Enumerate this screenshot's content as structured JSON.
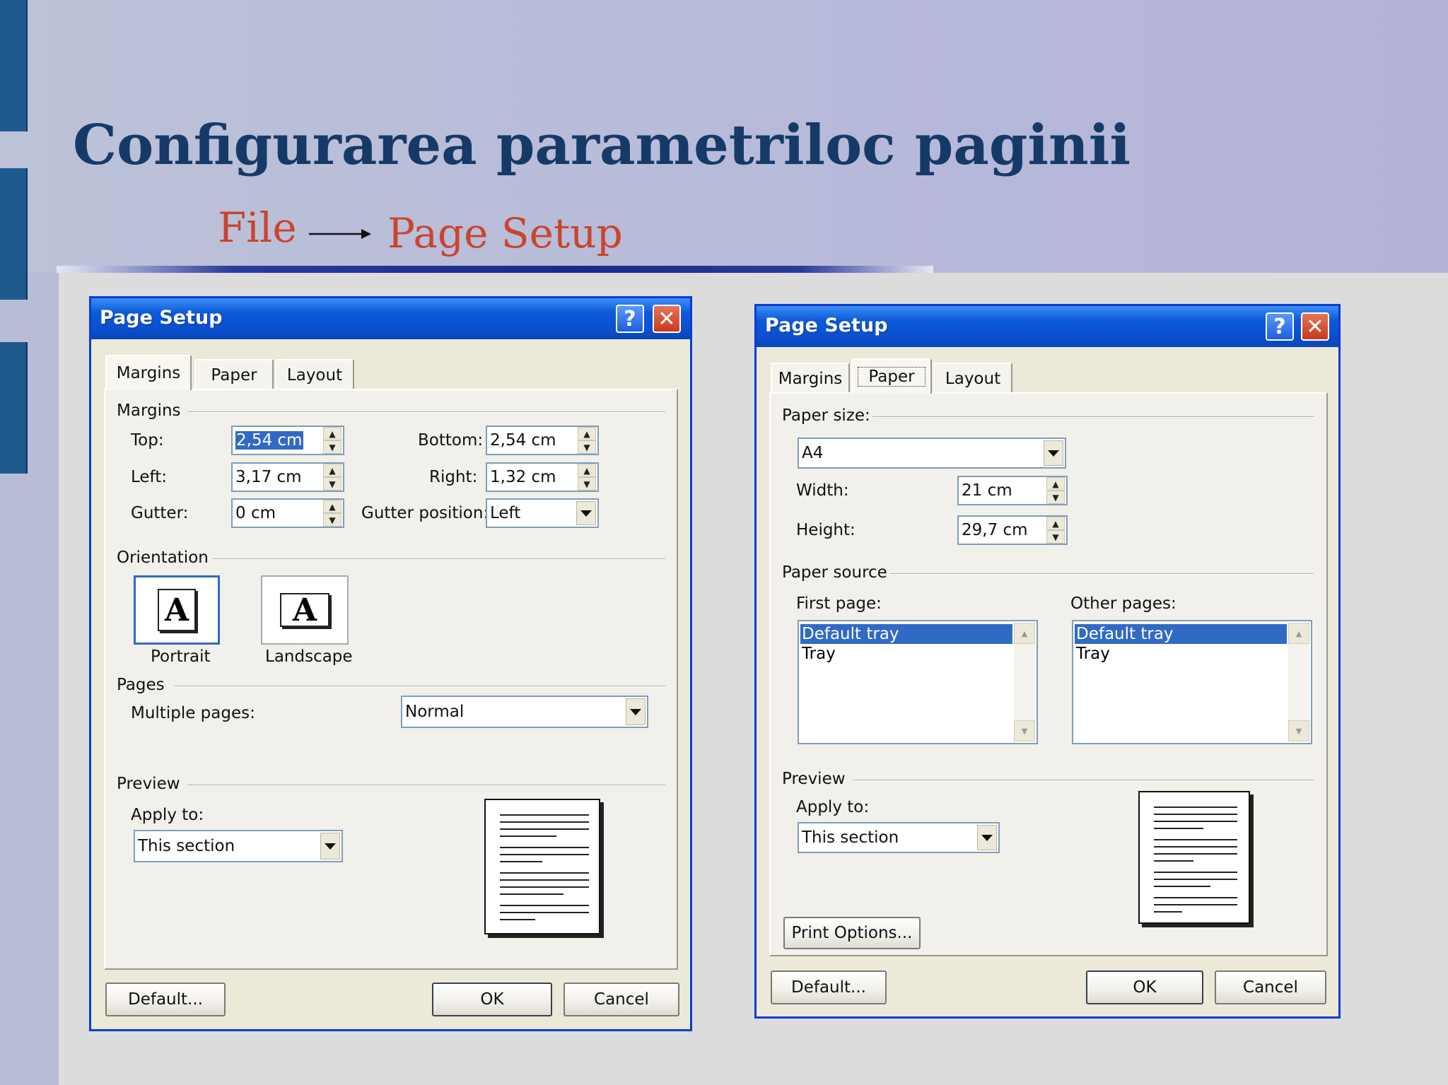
{
  "slide": {
    "title": "Configurarea parametriloc paginii",
    "path_from": "File",
    "path_to": "Page Setup",
    "colors": {
      "title": "#163a68",
      "path": "#c8452e",
      "sidebar": "#1f5a8e"
    }
  },
  "dialog_margins": {
    "title": "Page Setup",
    "help_label": "?",
    "close_label": "✕",
    "tabs": [
      "Margins",
      "Paper",
      "Layout"
    ],
    "active_tab": "Margins",
    "group_margins": "Margins",
    "top_label": "Top:",
    "top_value": "2,54 cm",
    "bottom_label": "Bottom:",
    "bottom_value": "2,54 cm",
    "left_label": "Left:",
    "left_value": "3,17 cm",
    "right_label": "Right:",
    "right_value": "1,32 cm",
    "gutter_label": "Gutter:",
    "gutter_value": "0 cm",
    "gutter_position_label": "Gutter position:",
    "gutter_position_value": "Left",
    "group_orientation": "Orientation",
    "portrait_label": "Portrait",
    "landscape_label": "Landscape",
    "orientation_glyph": "A",
    "group_pages": "Pages",
    "multiple_pages_label": "Multiple pages:",
    "multiple_pages_value": "Normal",
    "group_preview": "Preview",
    "apply_to_label": "Apply to:",
    "apply_to_value": "This section",
    "default_button": "Default...",
    "ok_button": "OK",
    "cancel_button": "Cancel"
  },
  "dialog_paper": {
    "title": "Page Setup",
    "help_label": "?",
    "close_label": "✕",
    "tabs": [
      "Margins",
      "Paper",
      "Layout"
    ],
    "active_tab": "Paper",
    "group_paper_size": "Paper size:",
    "paper_size_value": "A4",
    "width_label": "Width:",
    "width_value": "21 cm",
    "height_label": "Height:",
    "height_value": "29,7 cm",
    "group_paper_source": "Paper source",
    "first_page_label": "First page:",
    "other_pages_label": "Other pages:",
    "first_page_items": [
      "Default tray",
      "Tray"
    ],
    "other_pages_items": [
      "Default tray",
      "Tray"
    ],
    "group_preview": "Preview",
    "apply_to_label": "Apply to:",
    "apply_to_value": "This section",
    "print_options_button": "Print Options...",
    "default_button": "Default...",
    "ok_button": "OK",
    "cancel_button": "Cancel"
  }
}
